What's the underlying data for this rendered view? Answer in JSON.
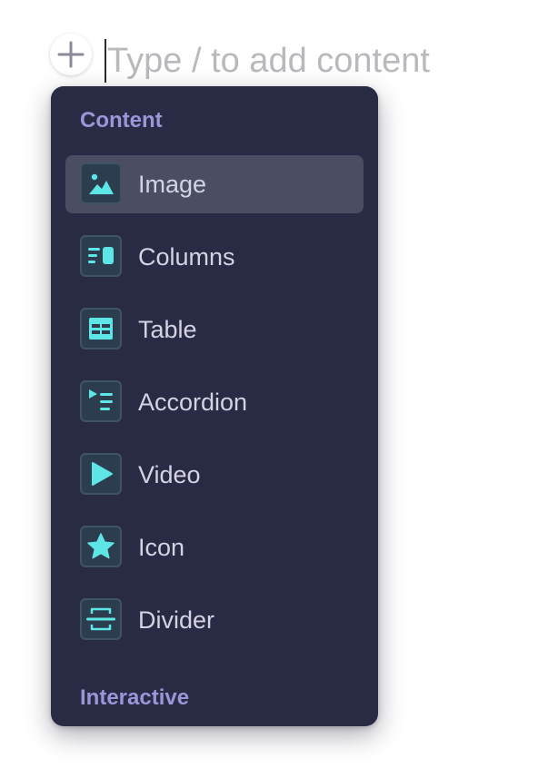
{
  "editor": {
    "placeholder": "Type / to add content",
    "add_icon": "plus-icon"
  },
  "menu": {
    "sections": [
      {
        "title": "Content"
      },
      {
        "title": "Interactive"
      }
    ],
    "items": [
      {
        "label": "Image",
        "icon": "image-icon",
        "selected": true
      },
      {
        "label": "Columns",
        "icon": "columns-icon",
        "selected": false
      },
      {
        "label": "Table",
        "icon": "table-icon",
        "selected": false
      },
      {
        "label": "Accordion",
        "icon": "accordion-icon",
        "selected": false
      },
      {
        "label": "Video",
        "icon": "video-icon",
        "selected": false
      },
      {
        "label": "Icon",
        "icon": "star-icon",
        "selected": false
      },
      {
        "label": "Divider",
        "icon": "divider-icon",
        "selected": false
      }
    ]
  },
  "colors": {
    "menu_background": "#292a43",
    "selected_background": "#4b4d63",
    "section_title": "#9d95d9",
    "icon_accent": "#5ee6e6",
    "placeholder_text": "#b9b9bd"
  }
}
